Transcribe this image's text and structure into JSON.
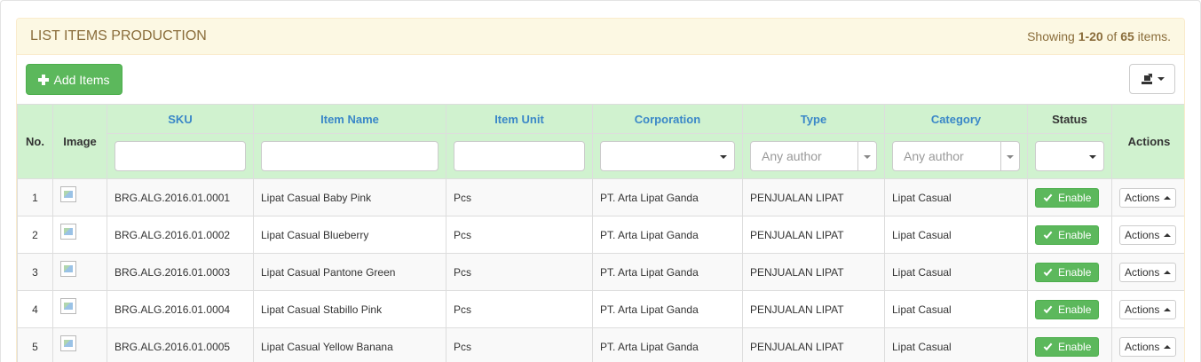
{
  "panel": {
    "title": "LIST ITEMS PRODUCTION",
    "showing_prefix": "Showing ",
    "showing_range": "1-20",
    "showing_of": " of ",
    "showing_total": "65",
    "showing_suffix": " items."
  },
  "toolbar": {
    "add_label": "Add Items",
    "export_icon": "export-icon"
  },
  "table": {
    "headers": {
      "no": "No.",
      "image": "Image",
      "sku": "SKU",
      "item_name": "Item Name",
      "item_unit": "Item Unit",
      "corporation": "Corporation",
      "type": "Type",
      "category": "Category",
      "status": "Status",
      "actions": "Actions"
    },
    "filters": {
      "sku": "",
      "item_name": "",
      "item_unit": "",
      "corporation": "",
      "type_placeholder": "Any author",
      "category_placeholder": "Any author",
      "status": ""
    },
    "rows": [
      {
        "no": "1",
        "sku": "BRG.ALG.2016.01.0001",
        "name": "Lipat Casual Baby Pink",
        "unit": "Pcs",
        "corp": "PT. Arta Lipat Ganda",
        "type": "PENJUALAN LIPAT",
        "category": "Lipat Casual",
        "status": "Enable",
        "action": "Actions"
      },
      {
        "no": "2",
        "sku": "BRG.ALG.2016.01.0002",
        "name": "Lipat Casual Blueberry",
        "unit": "Pcs",
        "corp": "PT. Arta Lipat Ganda",
        "type": "PENJUALAN LIPAT",
        "category": "Lipat Casual",
        "status": "Enable",
        "action": "Actions"
      },
      {
        "no": "3",
        "sku": "BRG.ALG.2016.01.0003",
        "name": "Lipat Casual Pantone Green",
        "unit": "Pcs",
        "corp": "PT. Arta Lipat Ganda",
        "type": "PENJUALAN LIPAT",
        "category": "Lipat Casual",
        "status": "Enable",
        "action": "Actions"
      },
      {
        "no": "4",
        "sku": "BRG.ALG.2016.01.0004",
        "name": "Lipat Casual Stabillo Pink",
        "unit": "Pcs",
        "corp": "PT. Arta Lipat Ganda",
        "type": "PENJUALAN LIPAT",
        "category": "Lipat Casual",
        "status": "Enable",
        "action": "Actions"
      },
      {
        "no": "5",
        "sku": "BRG.ALG.2016.01.0005",
        "name": "Lipat Casual Yellow Banana",
        "unit": "Pcs",
        "corp": "PT. Arta Lipat Ganda",
        "type": "PENJUALAN LIPAT",
        "category": "Lipat Casual",
        "status": "Enable",
        "action": "Actions"
      }
    ]
  },
  "colors": {
    "heading_bg": "#fcf8e3",
    "heading_text": "#8a6d3b",
    "header_bg": "#d0f2cf",
    "link_header": "#3a87c8",
    "success": "#5cb85c"
  }
}
